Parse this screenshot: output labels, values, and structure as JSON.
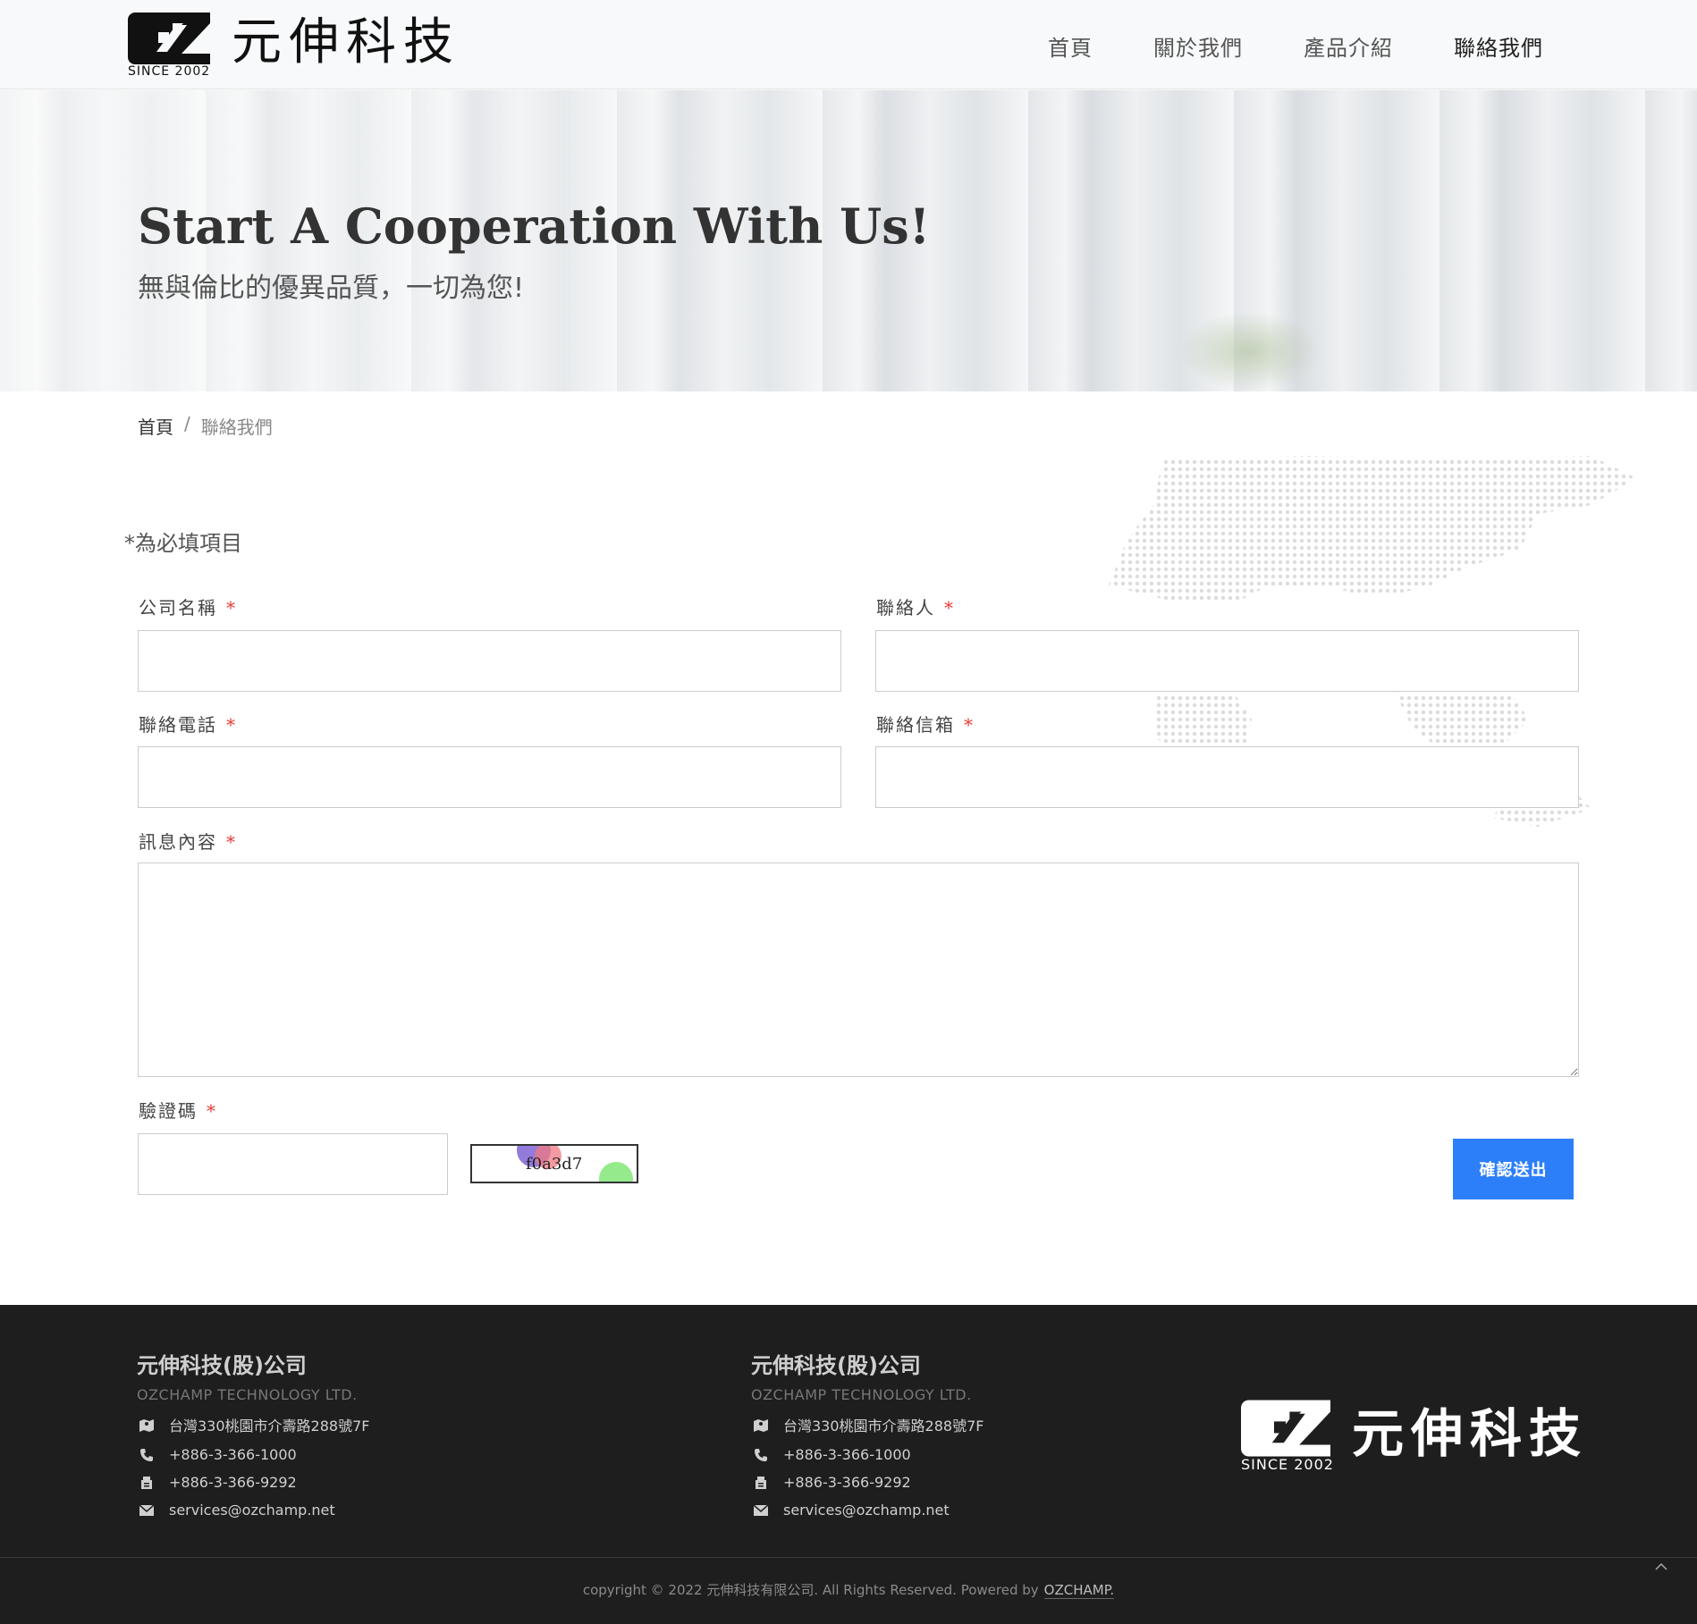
{
  "header": {
    "logo_since": "SINCE 2002",
    "logo_text": "元伸科技",
    "nav": [
      {
        "label": "首頁"
      },
      {
        "label": "關於我們"
      },
      {
        "label": "產品介紹"
      },
      {
        "label": "聯絡我們"
      }
    ]
  },
  "hero": {
    "title": "Start A Cooperation With Us!",
    "subtitle": "無與倫比的優異品質，一切為您!"
  },
  "breadcrumb": {
    "home": "首頁",
    "separator": "/",
    "current": "聯絡我們"
  },
  "form": {
    "required_note": "*為必填項目",
    "star": "*",
    "company_label": "公司名稱",
    "contact_label": "聯絡人",
    "phone_label": "聯絡電話",
    "email_label": "聯絡信箱",
    "message_label": "訊息內容",
    "captcha_label": "驗證碼",
    "captcha_code": "f0a3d7",
    "submit_label": "確認送出"
  },
  "footer": {
    "columns": [
      {
        "title": "元伸科技(股)公司",
        "subtitle": "OZCHAMP TECHNOLOGY LTD.",
        "address": "台灣330桃園市介壽路288號7F",
        "phone": "+886-3-366-1000",
        "fax": "+886-3-366-9292",
        "email": "services@ozchamp.net"
      },
      {
        "title": "元伸科技(股)公司",
        "subtitle": "OZCHAMP TECHNOLOGY LTD.",
        "address": "台灣330桃園市介壽路288號7F",
        "phone": "+886-3-366-1000",
        "fax": "+886-3-366-9292",
        "email": "services@ozchamp.net"
      }
    ],
    "logo_since": "SINCE 2002",
    "logo_text": "元伸科技",
    "copyright": "copyright © 2022 元伸科技有限公司. All Rights Reserved. Powered by",
    "powered_brand": "OZCHAMP."
  },
  "colors": {
    "accent": "#2d7ff9",
    "required_star": "#e53935",
    "footer_bg": "#1e1e1e"
  }
}
